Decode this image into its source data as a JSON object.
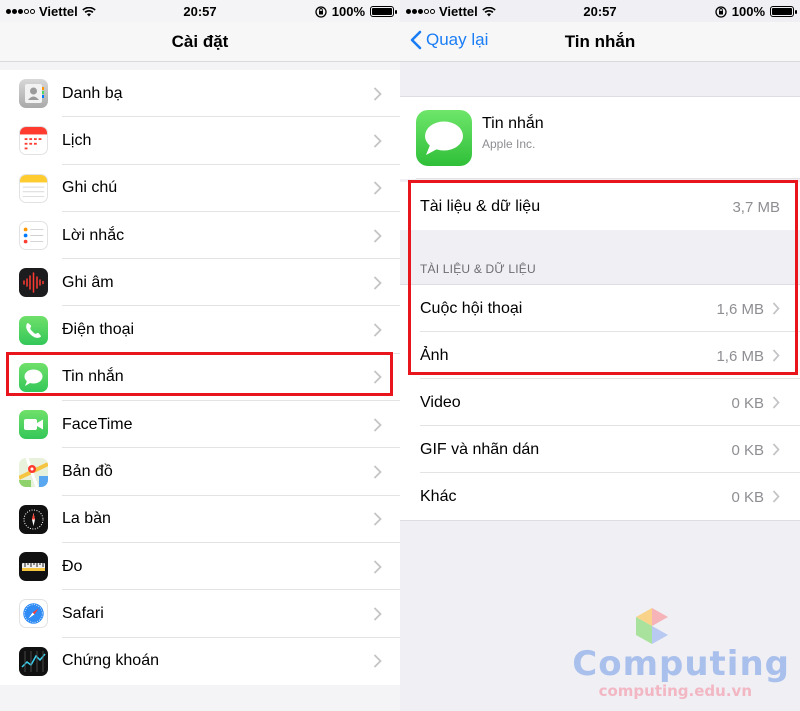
{
  "left": {
    "status": {
      "carrier": "Viettel",
      "time": "20:57",
      "battery": "100%"
    },
    "nav_title": "Cài đặt",
    "items": [
      {
        "label": "Danh bạ",
        "icon": "contacts-icon"
      },
      {
        "label": "Lịch",
        "icon": "calendar-icon"
      },
      {
        "label": "Ghi chú",
        "icon": "notes-icon"
      },
      {
        "label": "Lời nhắc",
        "icon": "reminders-icon"
      },
      {
        "label": "Ghi âm",
        "icon": "voice-memos-icon"
      },
      {
        "label": "Điện thoại",
        "icon": "phone-icon"
      },
      {
        "label": "Tin nhắn",
        "icon": "messages-icon"
      },
      {
        "label": "FaceTime",
        "icon": "facetime-icon"
      },
      {
        "label": "Bản đồ",
        "icon": "maps-icon"
      },
      {
        "label": "La bàn",
        "icon": "compass-icon"
      },
      {
        "label": "Đo",
        "icon": "measure-icon"
      },
      {
        "label": "Safari",
        "icon": "safari-icon"
      },
      {
        "label": "Chứng khoán",
        "icon": "stocks-icon"
      }
    ]
  },
  "right": {
    "status": {
      "carrier": "Viettel",
      "time": "20:57",
      "battery": "100%"
    },
    "back_label": "Quay lại",
    "nav_title": "Tin nhắn",
    "app": {
      "name": "Tin nhắn",
      "developer": "Apple Inc."
    },
    "total": {
      "label": "Tài liệu & dữ liệu",
      "value": "3,7 MB"
    },
    "section_header": "TÀI LIỆU & DỮ LIỆU",
    "details": [
      {
        "label": "Cuộc hội thoại",
        "value": "1,6 MB"
      },
      {
        "label": "Ảnh",
        "value": "1,6 MB"
      },
      {
        "label": "Video",
        "value": "0 KB"
      },
      {
        "label": "GIF và nhãn dán",
        "value": "0 KB"
      },
      {
        "label": "Khác",
        "value": "0 KB"
      }
    ]
  },
  "watermark": {
    "brand": "Computing",
    "url": "computing.edu.vn"
  },
  "colors": {
    "ios_blue": "#1a7df5",
    "highlight_red": "#e8151d",
    "messages_green": "#34c759"
  }
}
